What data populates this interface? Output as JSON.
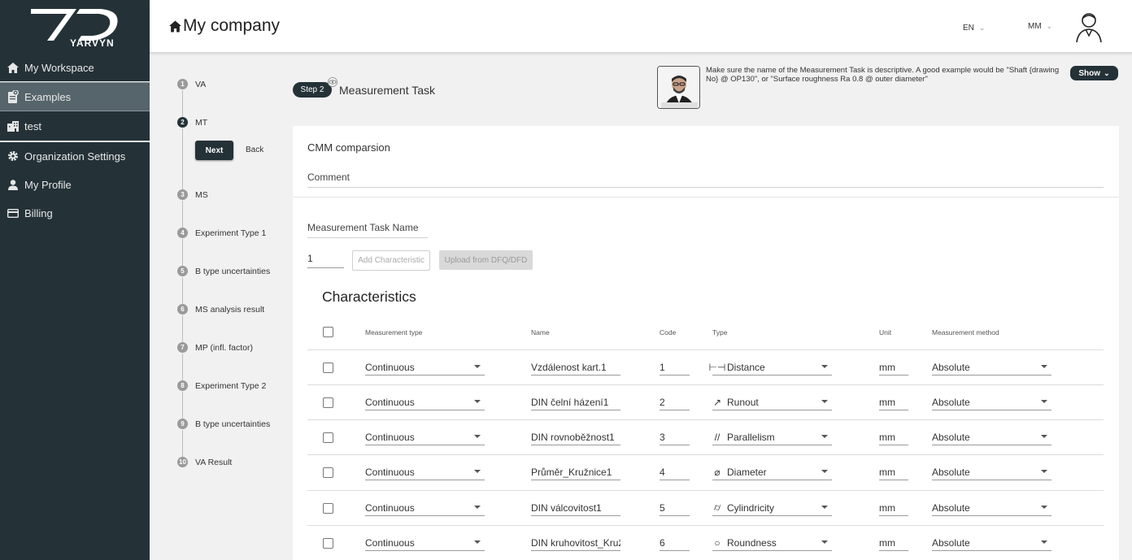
{
  "brand": {
    "name": "YARVYN"
  },
  "sidebar": {
    "items": [
      {
        "label": "My Workspace",
        "icon": "home-icon"
      },
      {
        "label": "Examples",
        "icon": "clipboard-icon"
      },
      {
        "label": "test",
        "icon": "building-icon"
      },
      {
        "label": "Organization Settings",
        "icon": "gear-icon"
      },
      {
        "label": "My Profile",
        "icon": "person-icon"
      },
      {
        "label": "Billing",
        "icon": "card-icon"
      }
    ]
  },
  "header": {
    "title": "My company",
    "language": "EN",
    "user_initials": "MM"
  },
  "stepper": {
    "steps": [
      {
        "num": "1",
        "label": "VA"
      },
      {
        "num": "2",
        "label": "MT"
      },
      {
        "num": "3",
        "label": "MS"
      },
      {
        "num": "4",
        "label": "Experiment Type 1"
      },
      {
        "num": "5",
        "label": "B type uncertainties"
      },
      {
        "num": "6",
        "label": "MS analysis result"
      },
      {
        "num": "7",
        "label": "MP (infl. factor)"
      },
      {
        "num": "8",
        "label": "Experiment Type 2"
      },
      {
        "num": "9",
        "label": "B type uncertainties"
      },
      {
        "num": "10",
        "label": "VA Result"
      }
    ],
    "next_label": "Next",
    "back_label": "Back"
  },
  "step_header": {
    "badge": "Step 2",
    "title": "Measurement Task"
  },
  "tip": {
    "text": "Make sure the name of the Measurement Task is descriptive. A good example would be \"Shaft {drawing No} @ OP130\", or \"Surface roughness Ra 0.8 @ outer diameter\"",
    "show_label": "Show"
  },
  "form": {
    "cmm_label": "CMM comparsion",
    "comment_placeholder": "Comment",
    "name_placeholder": "Measurement Task Name",
    "quantity": "1",
    "add_button": "Add Characteristic",
    "upload_button": "Upload from DFQ/DFD"
  },
  "characteristics": {
    "title": "Characteristics",
    "headers": {
      "measurement_type": "Measurement type",
      "name": "Name",
      "code": "Code",
      "type": "Type",
      "unit": "Unit",
      "measurement_method": "Measurement method"
    },
    "rows": [
      {
        "measurement_type": "Continuous",
        "name": "Vzdálenost kart.1",
        "code": "1",
        "type_symbol": "⊢⊣",
        "type": "Distance",
        "unit": "mm",
        "method": "Absolute"
      },
      {
        "measurement_type": "Continuous",
        "name": "DIN čelní házení1",
        "code": "2",
        "type_symbol": "↗",
        "type": "Runout",
        "unit": "mm",
        "method": "Absolute"
      },
      {
        "measurement_type": "Continuous",
        "name": "DIN rovnoběžnost1",
        "code": "3",
        "type_symbol": "//",
        "type": "Parallelism",
        "unit": "mm",
        "method": "Absolute"
      },
      {
        "measurement_type": "Continuous",
        "name": "Průměr_Kružnice1",
        "code": "4",
        "type_symbol": "⌀",
        "type": "Diameter",
        "unit": "mm",
        "method": "Absolute"
      },
      {
        "measurement_type": "Continuous",
        "name": "DIN válcovitost1",
        "code": "5",
        "type_symbol": "⌭",
        "type": "Cylindricity",
        "unit": "mm",
        "method": "Absolute"
      },
      {
        "measurement_type": "Continuous",
        "name": "DIN kruhovitost_Kruž",
        "code": "6",
        "type_symbol": "○",
        "type": "Roundness",
        "unit": "mm",
        "method": "Absolute"
      }
    ]
  }
}
